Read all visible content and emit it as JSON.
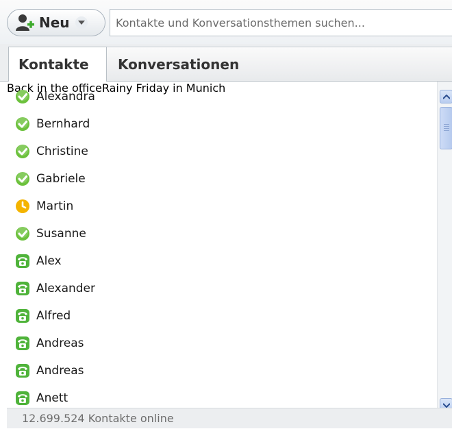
{
  "toolbar": {
    "new_label": "Neu",
    "search_placeholder": "Kontakte und Konversationsthemen suchen..."
  },
  "tabs": [
    {
      "label": "Kontakte",
      "active": true
    },
    {
      "label": "Konversationen",
      "active": false
    }
  ],
  "colors": {
    "online": "#6cc13c",
    "away": "#f4b400",
    "offline_phone": "#4fb33a"
  },
  "contacts": [
    {
      "name": "Alexandra",
      "status": "online",
      "status_icon": "online-check-icon",
      "mood": ""
    },
    {
      "name": "Bernhard",
      "status": "online",
      "status_icon": "online-check-icon",
      "mood": "Back in the office"
    },
    {
      "name": "Christine",
      "status": "online",
      "status_icon": "online-check-icon",
      "mood": ""
    },
    {
      "name": "Gabriele",
      "status": "online",
      "status_icon": "online-check-icon",
      "mood": ""
    },
    {
      "name": "Martin",
      "status": "away",
      "status_icon": "away-clock-icon",
      "mood": "Rainy Friday in Munich"
    },
    {
      "name": "Susanne",
      "status": "online",
      "status_icon": "online-check-icon",
      "mood": ""
    },
    {
      "name": "Alex",
      "status": "phone",
      "status_icon": "phone-icon",
      "mood": ""
    },
    {
      "name": "Alexander",
      "status": "phone",
      "status_icon": "phone-icon",
      "mood": ""
    },
    {
      "name": "Alfred",
      "status": "phone",
      "status_icon": "phone-icon",
      "mood": ""
    },
    {
      "name": "Andreas",
      "status": "phone",
      "status_icon": "phone-icon",
      "mood": ""
    },
    {
      "name": "Andreas",
      "status": "phone",
      "status_icon": "phone-icon",
      "mood": ""
    },
    {
      "name": "Anett",
      "status": "phone",
      "status_icon": "phone-icon",
      "mood": ""
    }
  ],
  "footer": {
    "online_count": "12.699.524 Kontakte online"
  }
}
